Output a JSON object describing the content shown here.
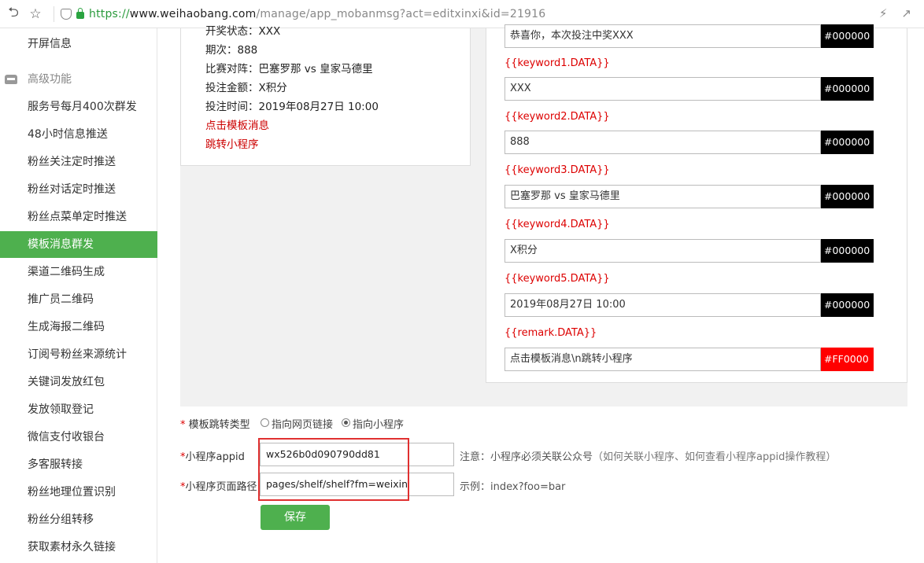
{
  "browser": {
    "url_scheme": "https://",
    "url_host": "www.weihaobang.com",
    "url_path": "/manage/app_mobanmsg?act=editxinxi&id=21916"
  },
  "sidebar": {
    "items_top": [
      {
        "label": "开屏信息"
      }
    ],
    "group": {
      "label": "高级功能",
      "icon": "inbox-icon"
    },
    "items": [
      {
        "label": "服务号每月400次群发"
      },
      {
        "label": "48小时信息推送"
      },
      {
        "label": "粉丝关注定时推送"
      },
      {
        "label": "粉丝对话定时推送"
      },
      {
        "label": "粉丝点菜单定时推送"
      },
      {
        "label": "模板消息群发",
        "active": true
      },
      {
        "label": "渠道二维码生成"
      },
      {
        "label": "推广员二维码"
      },
      {
        "label": "生成海报二维码"
      },
      {
        "label": "订阅号粉丝来源统计"
      },
      {
        "label": "关键词发放红包"
      },
      {
        "label": "发放领取登记"
      },
      {
        "label": "微信支付收银台"
      },
      {
        "label": "多客服转接"
      },
      {
        "label": "粉丝地理位置识别"
      },
      {
        "label": "粉丝分组转移"
      },
      {
        "label": "获取素材永久链接"
      }
    ],
    "active_color": "#4eb04e"
  },
  "preview": {
    "lines": [
      {
        "text": "开奖状态：XXX"
      },
      {
        "text": "期次：888"
      },
      {
        "text": "比赛对阵：巴塞罗那 vs 皇家马德里"
      },
      {
        "text": "投注金额：X积分"
      },
      {
        "text": "投注时间：2019年08月27日 10:00"
      },
      {
        "text": "点击模板消息",
        "red": true
      },
      {
        "text": "跳转小程序",
        "red": true
      }
    ]
  },
  "fields": [
    {
      "label": "",
      "value": "恭喜你，本次投注中奖XXX",
      "color": "#000000"
    },
    {
      "label": "{{keyword1.DATA}}",
      "value": "XXX",
      "color": "#000000"
    },
    {
      "label": "{{keyword2.DATA}}",
      "value": "888",
      "color": "#000000"
    },
    {
      "label": "{{keyword3.DATA}}",
      "value": "巴塞罗那 vs 皇家马德里",
      "color": "#000000"
    },
    {
      "label": "{{keyword4.DATA}}",
      "value": "X积分",
      "color": "#000000"
    },
    {
      "label": "{{keyword5.DATA}}",
      "value": "2019年08月27日 10:00",
      "color": "#000000"
    },
    {
      "label": "{{remark.DATA}}",
      "value": "点击模板消息\\n跳转小程序",
      "color": "#FF0000"
    }
  ],
  "jump": {
    "star": "*",
    "label": " 模板跳转类型",
    "option_web": "指向网页链接",
    "option_mini": "指向小程序",
    "selected": "mini"
  },
  "appid": {
    "star": "*",
    "label": "小程序appid",
    "value": "wx526b0d090790dd81",
    "hint": "注意：小程序必须关联公众号",
    "hint_muted": "（如何关联小程序、如何查看小程序appid操作教程）"
  },
  "pagepath": {
    "star": "*",
    "label": "小程序页面路径",
    "value": "pages/shelf/shelf?fm=weixin",
    "hint": "示例：index?foo=bar"
  },
  "save_label": "保存"
}
